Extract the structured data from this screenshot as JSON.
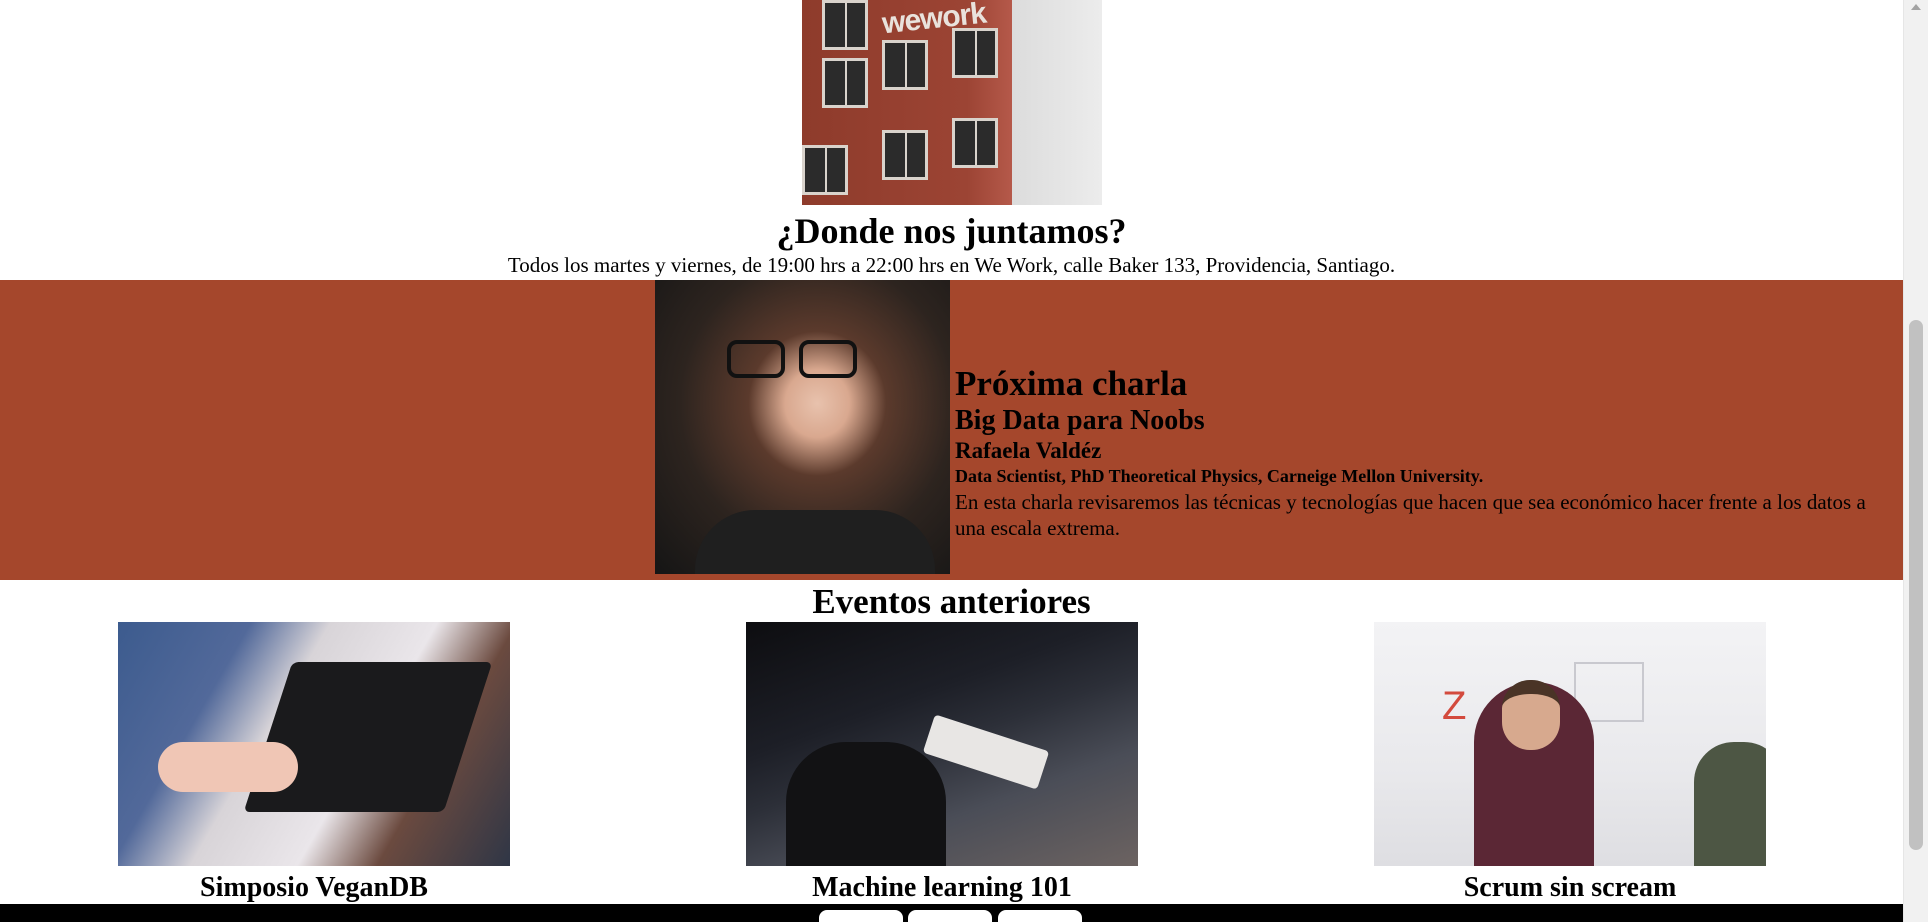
{
  "building": {
    "sign_text": "wework"
  },
  "location": {
    "title": "¿Donde nos juntamos?",
    "text": "Todos los martes y viernes, de 19:00 hrs a 22:00 hrs en We Work, calle Baker 133, Providencia, Santiago."
  },
  "next_talk": {
    "heading": "Próxima charla",
    "title": "Big Data para Noobs",
    "speaker": "Rafaela Valdéz",
    "role": "Data Scientist, PhD Theoretical Physics, Carneige Mellon University.",
    "description": "En esta charla revisaremos las técnicas y tecnologías que hacen que sea económico hacer frente a los datos a una escala extrema."
  },
  "past_events": {
    "title": "Eventos anteriores",
    "items": [
      {
        "name": "Simposio VeganDB"
      },
      {
        "name": "Machine learning 101"
      },
      {
        "name": "Scrum sin scream"
      }
    ]
  },
  "colors": {
    "band": "#a5472c",
    "footer": "#000000"
  }
}
